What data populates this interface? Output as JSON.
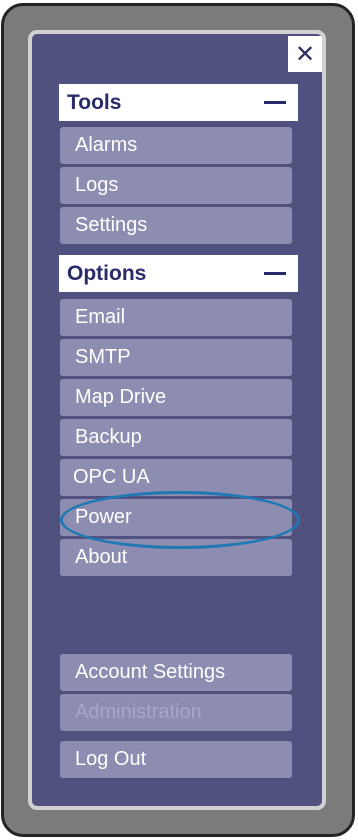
{
  "close": {
    "symbol": "✕"
  },
  "sections": {
    "tools": {
      "title": "Tools",
      "items": [
        "Alarms",
        "Logs",
        "Settings"
      ]
    },
    "options": {
      "title": "Options",
      "items": [
        "Email",
        "SMTP",
        "Map Drive",
        "Backup",
        "OPC UA",
        "Power",
        "About"
      ]
    }
  },
  "footer": {
    "items": [
      "Account Settings",
      "Administration",
      "Log Out"
    ],
    "disabled": [
      "Administration"
    ]
  },
  "colors": {
    "panel": "#515180",
    "item": "#8d8db1",
    "heading_text": "#2a2a6a",
    "highlight": "#1f78b4"
  }
}
